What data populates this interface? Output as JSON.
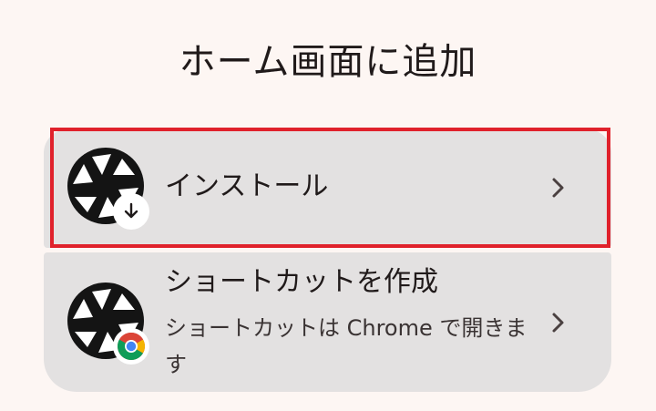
{
  "dialog": {
    "title": "ホーム画面に追加"
  },
  "options": [
    {
      "label": "インストール",
      "icon": "camera-shutter-icon",
      "badge_icon": "download-arrow-icon",
      "chevron_icon": "chevron-right-icon"
    },
    {
      "label": "ショートカットを作成",
      "description": "ショートカットは Chrome で開きます",
      "icon": "camera-shutter-icon",
      "badge_icon": "chrome-icon",
      "chevron_icon": "chevron-right-icon"
    }
  ],
  "colors": {
    "background": "#fdf6f3",
    "option_background": "#e3e1e1",
    "highlight_border": "#e0212b",
    "text": "#201a1a"
  }
}
